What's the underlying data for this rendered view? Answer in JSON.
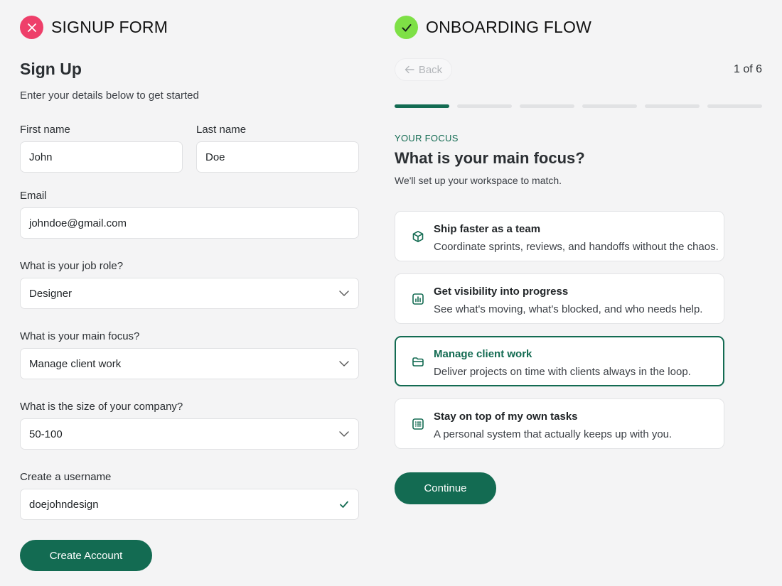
{
  "signup": {
    "section_title": "SIGNUP FORM",
    "title": "Sign Up",
    "subtitle": "Enter your details below to get started",
    "first_name": {
      "label": "First name",
      "value": "John"
    },
    "last_name": {
      "label": "Last name",
      "value": "Doe"
    },
    "email": {
      "label": "Email",
      "value": "johndoe@gmail.com"
    },
    "job_role": {
      "label": "What is your job role?",
      "value": "Designer"
    },
    "main_focus": {
      "label": "What is your main focus?",
      "value": "Manage client work"
    },
    "company_size": {
      "label": "What is the size of your company?",
      "value": "50-100"
    },
    "username": {
      "label": "Create a username",
      "value": "doejohndesign"
    },
    "submit_label": "Create Account"
  },
  "onboarding": {
    "section_title": "ONBOARDING FLOW",
    "back_label": "Back",
    "step_counter": "1 of 6",
    "current_step": 1,
    "total_steps": 6,
    "eyebrow": "YOUR FOCUS",
    "question": "What is your main focus?",
    "subtitle": "We'll set up your workspace to match.",
    "options": [
      {
        "title": "Ship faster as a team",
        "desc": "Coordinate sprints, reviews, and handoffs without the chaos.",
        "icon": "box-icon",
        "selected": false
      },
      {
        "title": "Get visibility into progress",
        "desc": "See what's moving, what's blocked, and who needs help.",
        "icon": "bar-chart-icon",
        "selected": false
      },
      {
        "title": "Manage client work",
        "desc": "Deliver projects on time with clients always in the loop.",
        "icon": "briefcase-icon",
        "selected": true
      },
      {
        "title": "Stay on top of my own tasks",
        "desc": "A personal system that actually keeps up with you.",
        "icon": "checklist-icon",
        "selected": false
      }
    ],
    "continue_label": "Continue"
  },
  "colors": {
    "accent": "#136b52",
    "error_badge": "#ee3f6a",
    "success_badge": "#7ee046",
    "background": "#f4f4f5"
  }
}
